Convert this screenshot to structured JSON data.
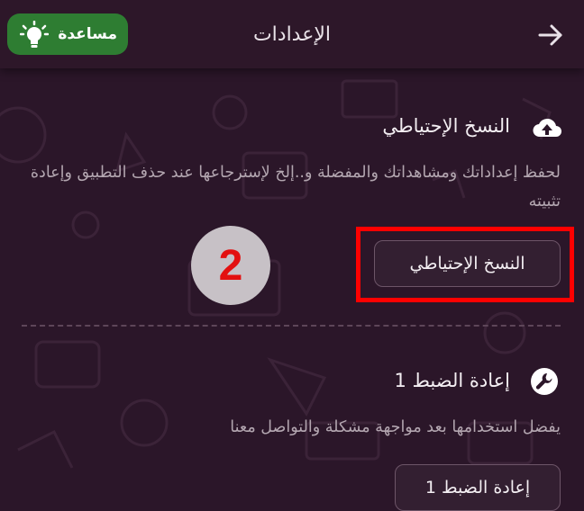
{
  "header": {
    "title": "الإعدادات",
    "back_icon": "arrow-right-icon",
    "help": {
      "label": "مساعدة",
      "icon": "lightbulb-icon",
      "color": "#2e7d32"
    }
  },
  "backup": {
    "title": "النسخ الإحتياطي",
    "icon": "cloud-upload-icon",
    "description": "لحفظ إعداداتك ومشاهداتك والمفضلة و..إلخ لإسترجاعها عند حذف التطبيق وإعادة تثبيته",
    "button_label": "النسخ الإحتياطي"
  },
  "annotation": {
    "step_number": "2",
    "highlight_color": "#ff0000"
  },
  "reset": {
    "title": "إعادة الضبط 1",
    "icon": "wrench-icon",
    "description": "يفضل استخدامها بعد مواجهة مشكلة والتواصل معنا",
    "button_label": "إعادة الضبط 1"
  },
  "colors": {
    "background": "#2b1629",
    "header": "#2d1729",
    "muted_text": "#b3a6b0"
  }
}
